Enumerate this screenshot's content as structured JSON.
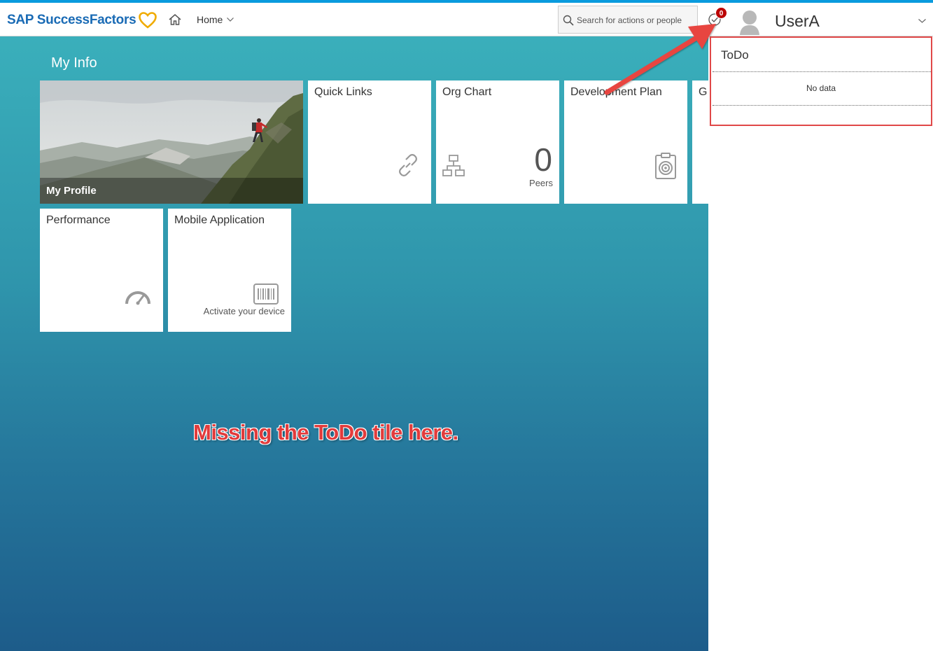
{
  "header": {
    "brand": "SAP SuccessFactors",
    "home_label": "Home",
    "search_placeholder": "Search for actions or people",
    "todo_badge_count": "0",
    "user_name": "UserA"
  },
  "main": {
    "section_title": "My Info",
    "tiles": {
      "profile": "My Profile",
      "quick_links": "Quick Links",
      "org_chart": "Org Chart",
      "org_chart_count": "0",
      "org_chart_unit": "Peers",
      "development_plan": "Development Plan",
      "goals_partial": "G",
      "performance": "Performance",
      "mobile_application": "Mobile Application",
      "mobile_footer": "Activate your device"
    }
  },
  "todo_panel": {
    "title": "ToDo",
    "empty_message": "No data"
  },
  "annotation": {
    "text": "Missing the ToDo tile here."
  },
  "colors": {
    "brand_blue": "#1a6bb5",
    "heart_gold": "#f0ab00",
    "annotation_red": "#e23b3b",
    "badge_red": "#bb0000"
  }
}
